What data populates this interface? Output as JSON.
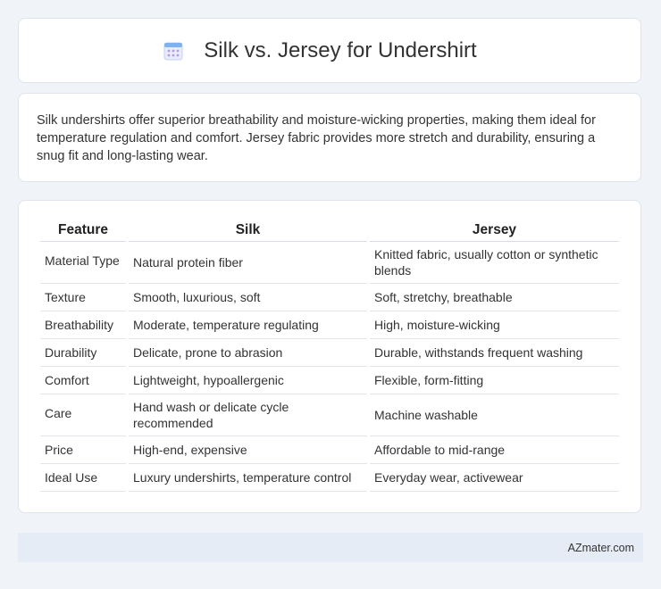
{
  "title": "Silk vs. Jersey for Undershirt",
  "intro": "Silk undershirts offer superior breathability and moisture-wicking properties, making them ideal for temperature regulation and comfort. Jersey fabric provides more stretch and durability, ensuring a snug fit and long-lasting wear.",
  "table": {
    "headers": [
      "Feature",
      "Silk",
      "Jersey"
    ],
    "rows": [
      [
        "Material Type",
        "Natural protein fiber",
        "Knitted fabric, usually cotton or synthetic blends"
      ],
      [
        "Texture",
        "Smooth, luxurious, soft",
        "Soft, stretchy, breathable"
      ],
      [
        "Breathability",
        "Moderate, temperature regulating",
        "High, moisture-wicking"
      ],
      [
        "Durability",
        "Delicate, prone to abrasion",
        "Durable, withstands frequent washing"
      ],
      [
        "Comfort",
        "Lightweight, hypoallergenic",
        "Flexible, form-fitting"
      ],
      [
        "Care",
        "Hand wash or delicate cycle recommended",
        "Machine washable"
      ],
      [
        "Price",
        "High-end, expensive",
        "Affordable to mid-range"
      ],
      [
        "Ideal Use",
        "Luxury undershirts, temperature control",
        "Everyday wear, activewear"
      ]
    ]
  },
  "footer": "AZmater.com",
  "icon": "calendar-icon",
  "colors": {
    "background": "#f0f3f8",
    "footer_bg": "#e6ecf6",
    "icon_accent": "#9aa6f0"
  }
}
